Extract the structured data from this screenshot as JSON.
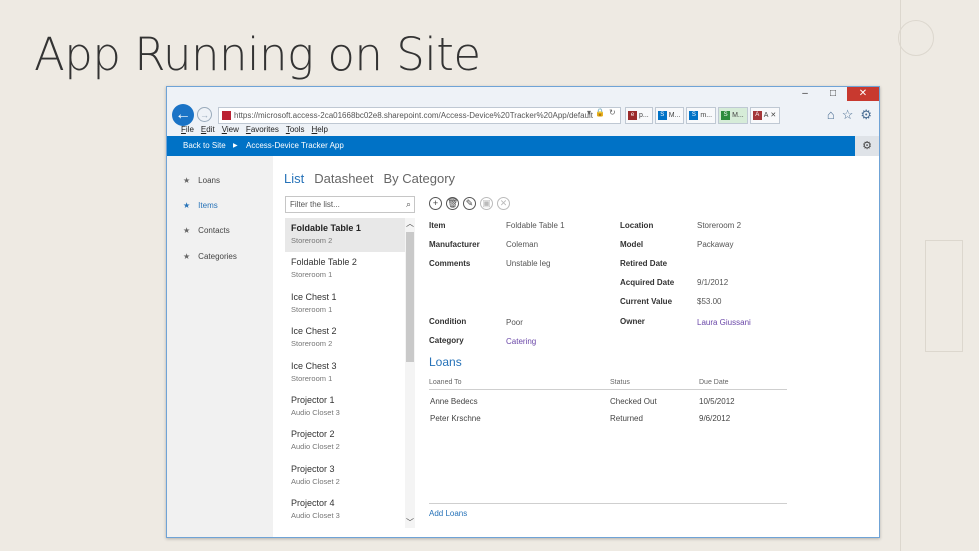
{
  "slide": {
    "title": "App Running on Site"
  },
  "browser": {
    "window_controls": [
      "–",
      "□",
      "✕"
    ],
    "url": "https://microsoft.access-2ca01668bc02e8.sharepoint.com/Access-Device%20Tracker%20App/default",
    "tabs": [
      {
        "label": "p...",
        "icon": "page-icon",
        "color": "#9b2b2b"
      },
      {
        "label": "M...",
        "icon": "sharepoint-icon",
        "color": "#0072c6"
      },
      {
        "label": "m...",
        "icon": "sharepoint-icon",
        "color": "#0072c6"
      },
      {
        "label": "M...",
        "icon": "sharepoint-icon",
        "color": "#2e8b3e"
      },
      {
        "label": "A",
        "icon": "access-icon",
        "color": "#a4373a"
      }
    ],
    "menu": [
      "File",
      "Edit",
      "View",
      "Favorites",
      "Tools",
      "Help"
    ]
  },
  "sharepoint": {
    "back_to_site": "Back to Site",
    "app_name": "Access-Device Tracker App"
  },
  "nav": [
    {
      "label": "Loans"
    },
    {
      "label": "Items"
    },
    {
      "label": "Contacts"
    },
    {
      "label": "Categories"
    }
  ],
  "view_tabs": [
    "List",
    "Datasheet",
    "By Category"
  ],
  "filter_placeholder": "Filter the list...",
  "items": [
    {
      "title": "Foldable Table 1",
      "sub": "Storeroom 2"
    },
    {
      "title": "Foldable Table 2",
      "sub": "Storeroom 1"
    },
    {
      "title": "Ice Chest 1",
      "sub": "Storeroom 1"
    },
    {
      "title": "Ice Chest 2",
      "sub": "Storeroom 2"
    },
    {
      "title": "Ice Chest 3",
      "sub": "Storeroom 1"
    },
    {
      "title": "Projector 1",
      "sub": "Audio Closet 3"
    },
    {
      "title": "Projector 2",
      "sub": "Audio Closet 2"
    },
    {
      "title": "Projector 3",
      "sub": "Audio Closet 2"
    },
    {
      "title": "Projector 4",
      "sub": "Audio Closet 3"
    }
  ],
  "action_icons": [
    {
      "name": "add-icon",
      "glyph": "+"
    },
    {
      "name": "delete-icon",
      "glyph": "🗑"
    },
    {
      "name": "edit-icon",
      "glyph": "✎"
    },
    {
      "name": "save-icon",
      "glyph": "▣"
    },
    {
      "name": "cancel-icon",
      "glyph": "✕"
    }
  ],
  "detail": {
    "item_label": "Item",
    "item": "Foldable Table 1",
    "manufacturer_label": "Manufacturer",
    "manufacturer": "Coleman",
    "comments_label": "Comments",
    "comments": "Unstable leg",
    "location_label": "Location",
    "location": "Storeroom 2",
    "model_label": "Model",
    "model": "Packaway",
    "retired_label": "Retired Date",
    "retired": "",
    "acquired_label": "Acquired Date",
    "acquired": "9/1/2012",
    "cost_label": "Current Value",
    "cost": "$53.00",
    "condition_label": "Condition",
    "condition": "Poor",
    "owner_label": "Owner",
    "owner": "Laura Giussani",
    "category_label": "Category",
    "category": "Catering"
  },
  "loans": {
    "heading": "Loans",
    "columns": [
      "Loaned To",
      "Status",
      "Due Date"
    ],
    "rows": [
      [
        "Anne Bedecs",
        "Checked Out",
        "10/5/2012"
      ],
      [
        "Peter Krschne",
        "Returned",
        "9/6/2012"
      ]
    ],
    "add_label": "Add Loans"
  }
}
